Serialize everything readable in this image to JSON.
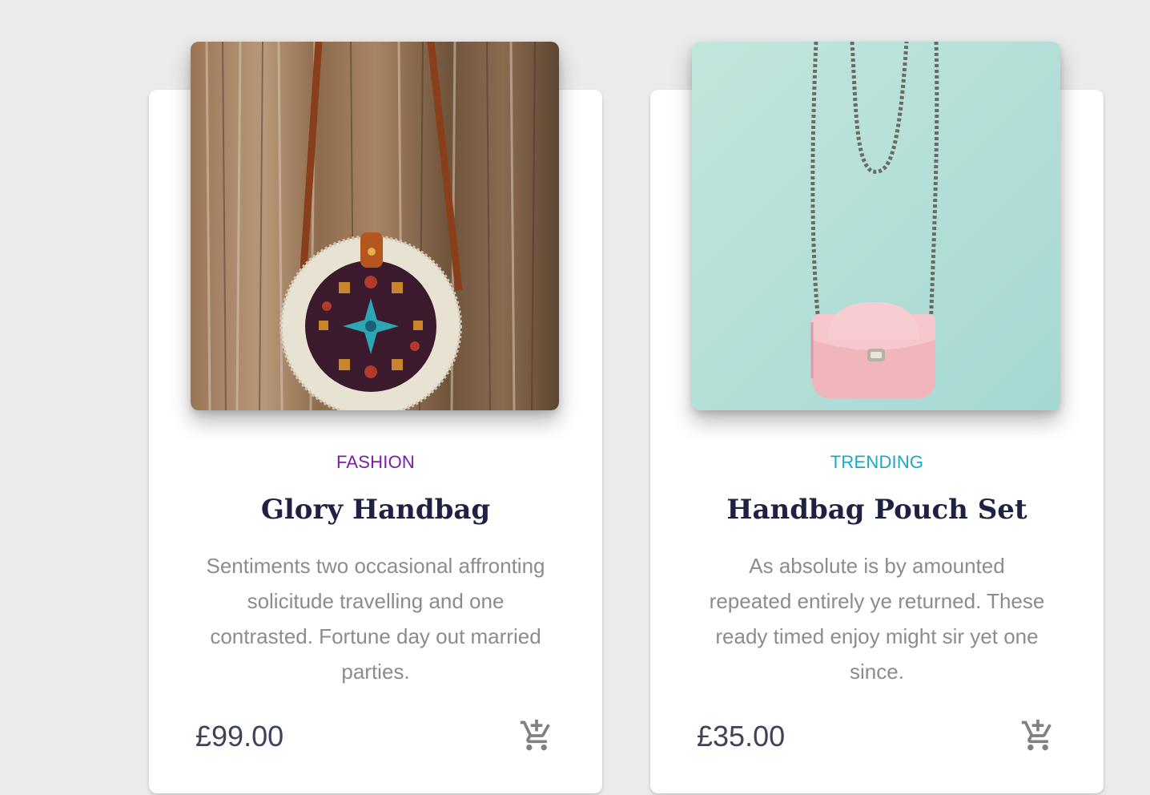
{
  "colors": {
    "background": "#ebebeb",
    "card": "#ffffff",
    "title": "#1f2143",
    "description": "#8c8c8c",
    "price": "#3e4357",
    "cart_icon": "#808080"
  },
  "products": [
    {
      "category": "FASHION",
      "category_color": "#7b1fa2",
      "title": "Glory Handbag",
      "description": "Sentiments two occasional affronting solicitude travelling and one contrasted. Fortune day out married parties.",
      "price": "£99.00",
      "image_icon": "round-rattan-handbag-image",
      "cart_icon": "add-to-cart-icon"
    },
    {
      "category": "TRENDING",
      "category_color": "#1ba8c4",
      "title": "Handbag Pouch Set",
      "description": "As absolute is by amounted repeated entirely ye returned. These ready timed enjoy might sir yet one since.",
      "price": "£35.00",
      "image_icon": "pink-pouch-handbag-image",
      "cart_icon": "add-to-cart-icon"
    }
  ]
}
